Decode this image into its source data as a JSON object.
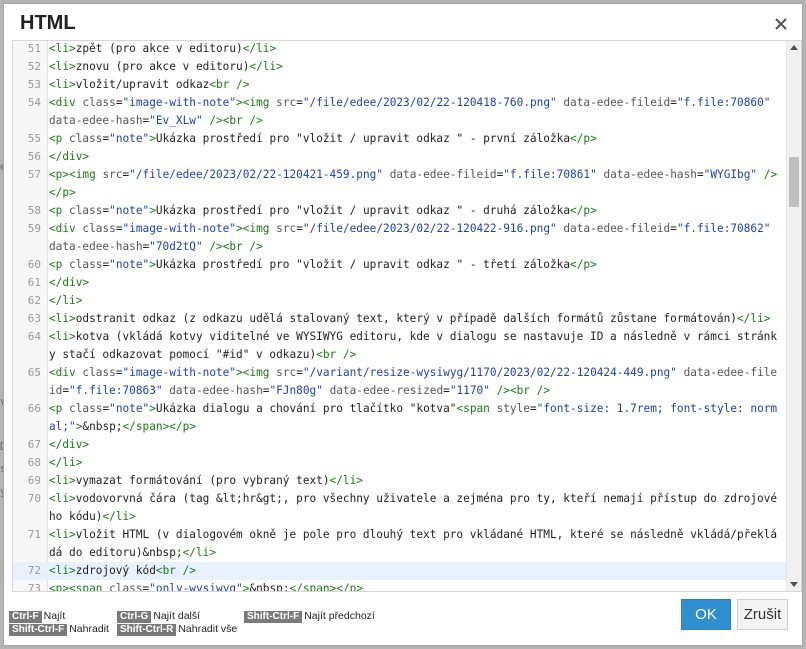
{
  "dialog": {
    "title": "HTML",
    "ok_label": "OK",
    "cancel_label": "Zrušit"
  },
  "backdrop_chars": [
    "e",
    "v",
    "D",
    "s",
    "y"
  ],
  "editor": {
    "lines": [
      {
        "n": "51",
        "text": "<li>zpět (pro akce v editoru)</li>"
      },
      {
        "n": "52",
        "text": "<li>znovu (pro akce v editoru)</li>"
      },
      {
        "n": "53",
        "text": "<li>vložit/upravit odkaz<br />"
      },
      {
        "n": "54",
        "text": "<div class=\"image-with-note\"><img src=\"/file/edee/2023/02/22-120418-760.png\" data-edee-fileid=\"f.file:70860\" data-edee-hash=\"Ev_XLw\" /><br />"
      },
      {
        "n": "55",
        "text": "<p class=\"note\">Ukázka prostředí pro \"vložit / upravit odkaz \" - první záložka</p>"
      },
      {
        "n": "56",
        "text": "</div>"
      },
      {
        "n": "57",
        "text": "<p><img src=\"/file/edee/2023/02/22-120421-459.png\" data-edee-fileid=\"f.file:70861\" data-edee-hash=\"WYGIbg\" /></p>"
      },
      {
        "n": "58",
        "text": "<p class=\"note\">Ukázka prostředí pro \"vložit / upravit odkaz \" - druhá záložka</p>"
      },
      {
        "n": "59",
        "text": "<div class=\"image-with-note\"><img src=\"/file/edee/2023/02/22-120422-916.png\" data-edee-fileid=\"f.file:70862\" data-edee-hash=\"70d2tQ\" /><br />"
      },
      {
        "n": "60",
        "text": "<p class=\"note\">Ukázka prostředí pro \"vložit / upravit odkaz \" - třetí záložka</p>"
      },
      {
        "n": "61",
        "text": "</div>"
      },
      {
        "n": "62",
        "text": "</li>"
      },
      {
        "n": "63",
        "text": "<li>odstranit odkaz (z odkazu udělá stalovaný text, který v případě dalších formátů zůstane formátován)</li>"
      },
      {
        "n": "64",
        "text": "<li>kotva (vkládá kotvy viditelné ve WYSIWYG editoru, kde v dialogu se nastavuje ID a následně v rámci stránky stačí odkazovat pomocí \"#id\" v odkazu)<br />"
      },
      {
        "n": "65",
        "text": "<div class=\"image-with-note\"><img src=\"/variant/resize-wysiwyg/1170/2023/02/22-120424-449.png\" data-edee-fileid=\"f.file:70863\" data-edee-hash=\"FJn80g\" data-edee-resized=\"1170\" /><br />"
      },
      {
        "n": "66",
        "text": "<p class=\"note\">Ukázka dialogu a chování pro tlačítko \"kotva\"<span style=\"font-size: 1.7rem; font-style: normal;\">&nbsp;</span></p>"
      },
      {
        "n": "67",
        "text": "</div>"
      },
      {
        "n": "68",
        "text": "</li>"
      },
      {
        "n": "69",
        "text": "<li>vymazat formátování (pro vybraný text)</li>"
      },
      {
        "n": "70",
        "text": "<li>vodovorvná čára (tag &lt;hr&gt;, pro všechny uživatele a zejména pro ty, kteří nemají přístup do zdrojového kódu)</li>"
      },
      {
        "n": "71",
        "text": "<li>vložit HTML (v dialogovém okně je pole pro dlouhý text pro vkládané HTML, které se následně vkládá/překládá do editoru)&nbsp;</li>"
      },
      {
        "n": "72",
        "text": "<li>zdrojový kód<br />",
        "active": true
      },
      {
        "n": "73",
        "text": "<p><span class=\"only-wysiwyg\">&nbsp;</span></p>"
      }
    ]
  },
  "shortcuts": [
    {
      "key": "Ctrl-F",
      "label": "Najít"
    },
    {
      "key": "Shift-Ctrl-F",
      "label": "Nahradit"
    },
    {
      "key": "Ctrl-G",
      "label": "Najít další"
    },
    {
      "key": "Shift-Ctrl-R",
      "label": "Nahradit vše"
    },
    {
      "key": "Shift-Ctrl-F",
      "label": "Najít předchozí"
    }
  ],
  "icons": {
    "close": "close-icon",
    "scroll_up": "chevron-up-icon",
    "scroll_down": "chevron-down-icon"
  },
  "colors": {
    "ok_button": "#2f8fd0",
    "active_line": "#e8f2ff",
    "tag": "#1a7a14",
    "attr_value": "#1c3fb8"
  }
}
